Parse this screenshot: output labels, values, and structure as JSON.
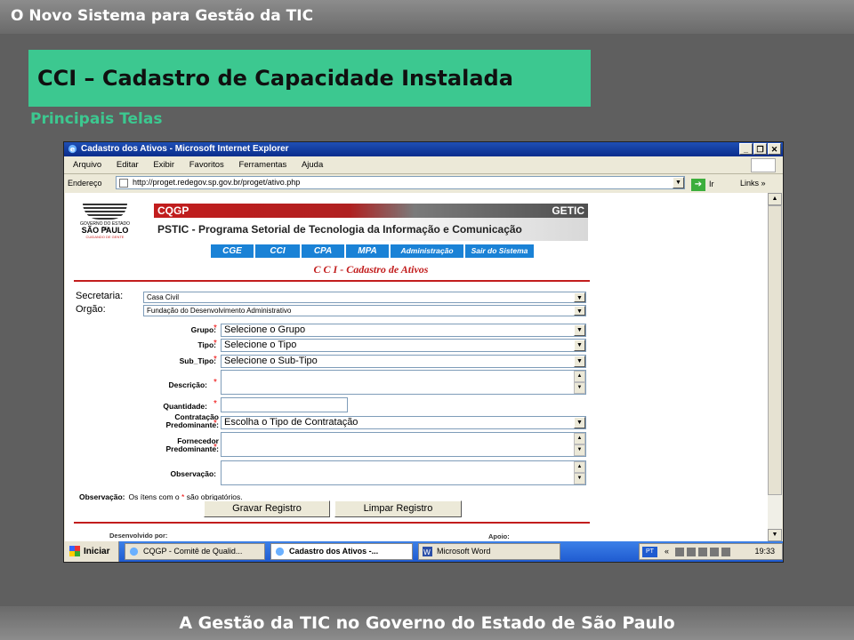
{
  "slide": {
    "header": "O Novo Sistema para Gestão da TIC",
    "title": "CCI – Cadastro de Capacidade Instalada",
    "subtitle": "Principais Telas",
    "footer": "A Gestão da TIC  no Governo do Estado de São Paulo"
  },
  "window": {
    "title": "Cadastro dos Ativos - Microsoft Internet Explorer",
    "menu": [
      "Arquivo",
      "Editar",
      "Exibir",
      "Favoritos",
      "Ferramentas",
      "Ajuda"
    ],
    "address_label": "Endereço",
    "address": "http://proget.redegov.sp.gov.br/proget/ativo.php",
    "go_label": "Ir",
    "links_label": "Links"
  },
  "page": {
    "logo_line1": "GOVERNO DO ESTADO DE",
    "logo_line2": "SÃO PAULO",
    "logo_line3": "CUIDANDO DE GENTE",
    "band_left": "CQGP",
    "band_right": "GETIC",
    "program": "PSTIC - Programa Setorial de Tecnologia da Informação e Comunicação",
    "tabs": [
      "CGE",
      "CCI",
      "CPA",
      "MPA",
      "Administração",
      "Sair do Sistema"
    ],
    "form_title": "C C I - Cadastro de Ativos",
    "secretaria_label": "Secretaria:",
    "secretaria_value": "Casa Civil",
    "orgao_label": "Orgão:",
    "orgao_value": "Fundação do Desenvolvimento Administrativo",
    "grupo_label": "Grupo:",
    "grupo_value": "Selecione o Grupo",
    "tipo_label": "Tipo:",
    "tipo_value": "Selecione o Tipo",
    "subtipo_label": "Sub_Tipo:",
    "subtipo_value": "Selecione o Sub-Tipo",
    "descricao_label": "Descrição:",
    "quantidade_label": "Quantidade:",
    "contratacao_label1": "Contratação",
    "contratacao_label2": "Predominante:",
    "contratacao_value": "Escolha o Tipo de Contratação",
    "fornecedor_label1": "Fornecedor",
    "fornecedor_label2": "Predominante:",
    "observacao_label": "Observação:",
    "required_mark": "*",
    "note_label": "Observação:",
    "note_text_a": "Os ítens com o",
    "note_text_b": "são obrigatórios.",
    "save_button": "Gravar Registro",
    "clear_button": "Limpar Registro",
    "footer_left": "Desenvolvido por:",
    "footer_right": "Apoio:"
  },
  "taskbar": {
    "start": "Iniciar",
    "tasks": [
      "CQGP - Comitê de Qualid...",
      "Cadastro dos Ativos -...",
      "Microsoft Word"
    ],
    "lang": "PT",
    "chevron": "«",
    "clock": "19:33"
  }
}
